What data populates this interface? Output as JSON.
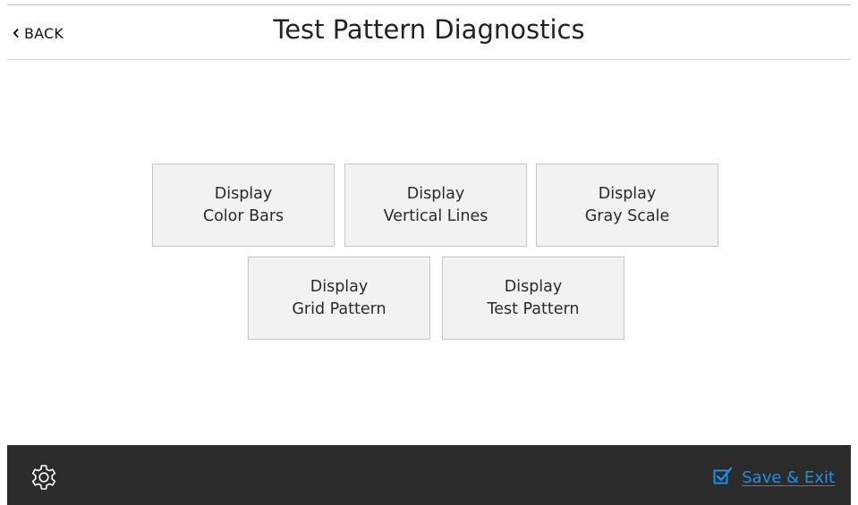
{
  "header": {
    "back_label": "BACK",
    "title": "Test Pattern Diagnostics"
  },
  "buttons": [
    {
      "line1": "Display",
      "line2": "Color Bars"
    },
    {
      "line1": "Display",
      "line2": "Vertical Lines"
    },
    {
      "line1": "Display",
      "line2": "Gray Scale"
    },
    {
      "line1": "Display",
      "line2": "Grid Pattern"
    },
    {
      "line1": "Display",
      "line2": "Test Pattern"
    }
  ],
  "footer": {
    "settings_icon": "gear-icon",
    "save_label": "Save & Exit",
    "save_icon": "checkbox-checked-icon",
    "accent_color": "#1d8fe0",
    "bar_color": "#2b2b2b"
  }
}
